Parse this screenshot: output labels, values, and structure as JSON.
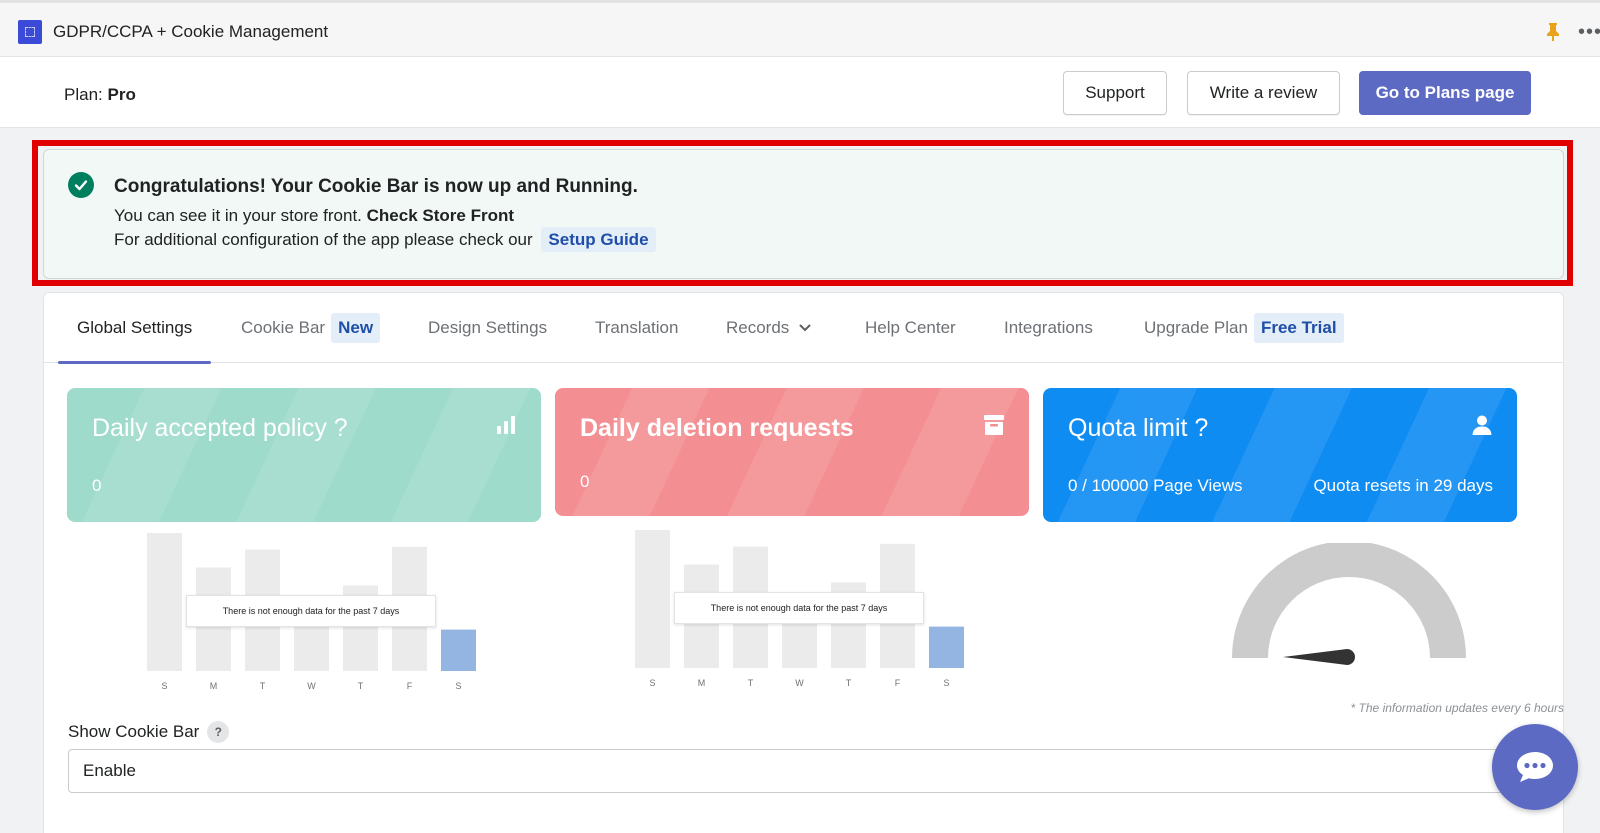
{
  "titlebar": {
    "title": "GDPR/CCPA + Cookie Management",
    "more_label": "•••"
  },
  "header": {
    "plan_prefix": "Plan:",
    "plan_name": "Pro",
    "support_label": "Support",
    "review_label": "Write a review",
    "plans_label": "Go to Plans page"
  },
  "banner": {
    "title": "Congratulations! Your Cookie Bar is now up and Running.",
    "line1_text": "You can see it in your store front.",
    "line1_link": "Check Store Front",
    "line2_text": "For additional configuration of the app please check our",
    "line2_link": "Setup Guide"
  },
  "tabs": [
    {
      "label": "Global Settings",
      "active": true
    },
    {
      "label": "Cookie Bar",
      "badge": "New"
    },
    {
      "label": "Design Settings"
    },
    {
      "label": "Translation"
    },
    {
      "label": "Records"
    },
    {
      "label": "Help Center"
    },
    {
      "label": "Integrations"
    },
    {
      "label": "Upgrade Plan",
      "badge": "Free Trial"
    }
  ],
  "stats": {
    "accepted": {
      "title": "Daily accepted policy ?",
      "value": "0",
      "color": "#9edbcb"
    },
    "deletion": {
      "title": "Daily deletion requests",
      "value": "0",
      "color": "#f38f92"
    },
    "quota": {
      "title": "Quota limit ?",
      "value": "0 / 100000 Page Views",
      "resets": "Quota resets in 29 days",
      "color": "#0f8cf2"
    }
  },
  "chart_data": [
    {
      "type": "bar",
      "categories": [
        "S",
        "M",
        "T",
        "W",
        "T",
        "F",
        "S"
      ],
      "values": [
        0,
        0,
        0,
        0,
        0,
        0,
        0
      ],
      "placeholder_heights": [
        100,
        75,
        88,
        55,
        62,
        90,
        30
      ],
      "message": "There is not enough data for the past 7 days"
    },
    {
      "type": "bar",
      "categories": [
        "S",
        "M",
        "T",
        "W",
        "T",
        "F",
        "S"
      ],
      "values": [
        0,
        0,
        0,
        0,
        0,
        0,
        0
      ],
      "placeholder_heights": [
        100,
        75,
        88,
        55,
        62,
        90,
        30
      ],
      "message": "There is not enough data for the past 7 days"
    }
  ],
  "gauge": {
    "value": 0,
    "max": 100000
  },
  "info_note": "* The information updates every 6 hours",
  "form": {
    "show_cookie_bar_label": "Show Cookie Bar",
    "help": "?",
    "show_cookie_bar_value": "Enable"
  },
  "colors": {
    "accent": "#5c6ac4",
    "highlight": "#e00000",
    "bar_placeholder": "#ebebeb",
    "bar_today": "#94b5e2"
  }
}
